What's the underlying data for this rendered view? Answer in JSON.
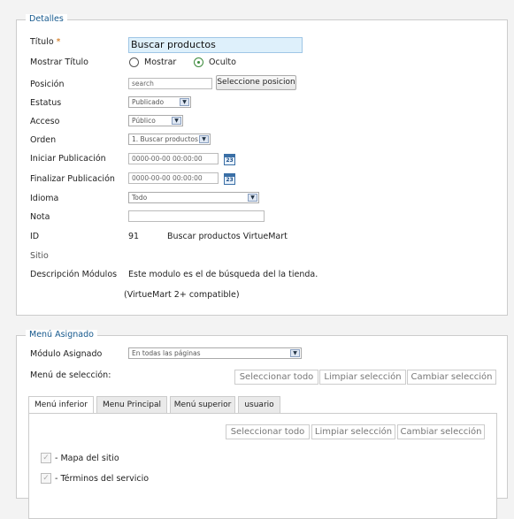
{
  "detalles": {
    "legend": "Detalles",
    "titulo_label": "Título",
    "titulo_required": "*",
    "titulo_value": "Buscar productos",
    "mostrar_titulo_label": "Mostrar Título",
    "mostrar_option": "Mostrar",
    "oculto_option": "Oculto",
    "posicion_label": "Posición",
    "posicion_value": "search",
    "seleccione_posicion_button": "Seleccione posicion",
    "estatus_label": "Estatus",
    "estatus_value": "Publicado",
    "acceso_label": "Acceso",
    "acceso_value": "Público",
    "orden_label": "Orden",
    "orden_value": "1. Buscar productos",
    "iniciar_label": "Iniciar Publicación",
    "iniciar_value": "0000-00-00 00:00:00",
    "finalizar_label": "Finalizar Publicación",
    "finalizar_value": "0000-00-00 00:00:00",
    "calendar_icon_text": "23",
    "idioma_label": "Idioma",
    "idioma_value": "Todo",
    "nota_label": "Nota",
    "nota_value": "",
    "id_label": "ID",
    "id_value": "91",
    "id_name": "Buscar productos VirtueMart",
    "sitio_label": "Sitio",
    "descripcion_label": "Descripción Módulos",
    "descripcion_line1": "Este modulo es el de búsqueda del la tienda.",
    "descripcion_line2": "(VirtueMart 2+ compatible)"
  },
  "menu": {
    "legend": "Menú Asignado",
    "modulo_asignado_label": "Módulo Asignado",
    "modulo_asignado_value": "En todas las páginas",
    "menu_seleccion_label": "Menú de selección:",
    "seleccionar_todo": "Seleccionar todo",
    "limpiar_seleccion": "Limpiar selección",
    "cambiar_seleccion": "Cambiar selección",
    "tabs": [
      "Menú inferior",
      "Menu Principal",
      "Menú superior",
      "usuario"
    ],
    "items": [
      "- Mapa del sitio",
      "- Términos del servicio"
    ]
  }
}
